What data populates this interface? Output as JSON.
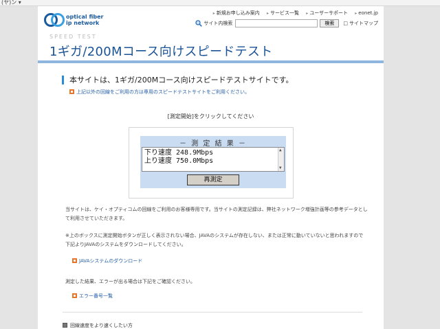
{
  "browser": {
    "strip_text": "(ヤ)ン ▾"
  },
  "header": {
    "logo_line1": "optical fiber",
    "logo_line2": "ip network",
    "nav": [
      "新規お申し込み案内",
      "サービス一覧",
      "ユーザーサポート",
      "eonet.jp"
    ],
    "search_label": "サイト内検索",
    "search_value": "",
    "search_button": "検索",
    "sitemap_label": "サイトマップ"
  },
  "page": {
    "speedtest_label": "SPEED TEST",
    "title": "1ギガ/200Mコース向けスピードテスト",
    "lead": "本サイトは、1ギガ/200Mコース向けスピードテストサイトです。",
    "subnote": "上記以外の回線をご利用の方は専用のスピードテストサイトをご利用ください。",
    "click_instruction": "[測定開始]をクリックしてください"
  },
  "result": {
    "header": "－ 測 定 結 果 －",
    "lines": [
      "下り速度 248.9Mbps",
      "上り速度 750.0Mbps"
    ],
    "scroll_up": "▲",
    "scroll_down": "▼",
    "remeasure_button": "再測定"
  },
  "info": {
    "para1": "当サイトは、ケイ・オプティコムの回線をご利用のお客様専用です。当サイトの測定記録は、弊社ネットワーク増強計画等の参考データとして利用させていただきます。",
    "para2": "※上のボックスに測定開始ボタンが正しく表示されない場合、JAVAのシステムが存在しない、または正常に動いていないと思われますので下記よりJAVAのシステムをダウンロードしてください。",
    "java_link": "JAVAシステムのダウンロード",
    "para3": "測定した結果、エラーが出る場合は下記をご確認ください。",
    "error_link": "エラー番号一覧",
    "bottom_item": "回線速度をより速くしたい方"
  },
  "colors": {
    "title_blue": "#1a5296",
    "accent_blue": "#2d8ad5",
    "result_panel": "#c9dcf1",
    "bullet_orange": "#e8742a"
  }
}
